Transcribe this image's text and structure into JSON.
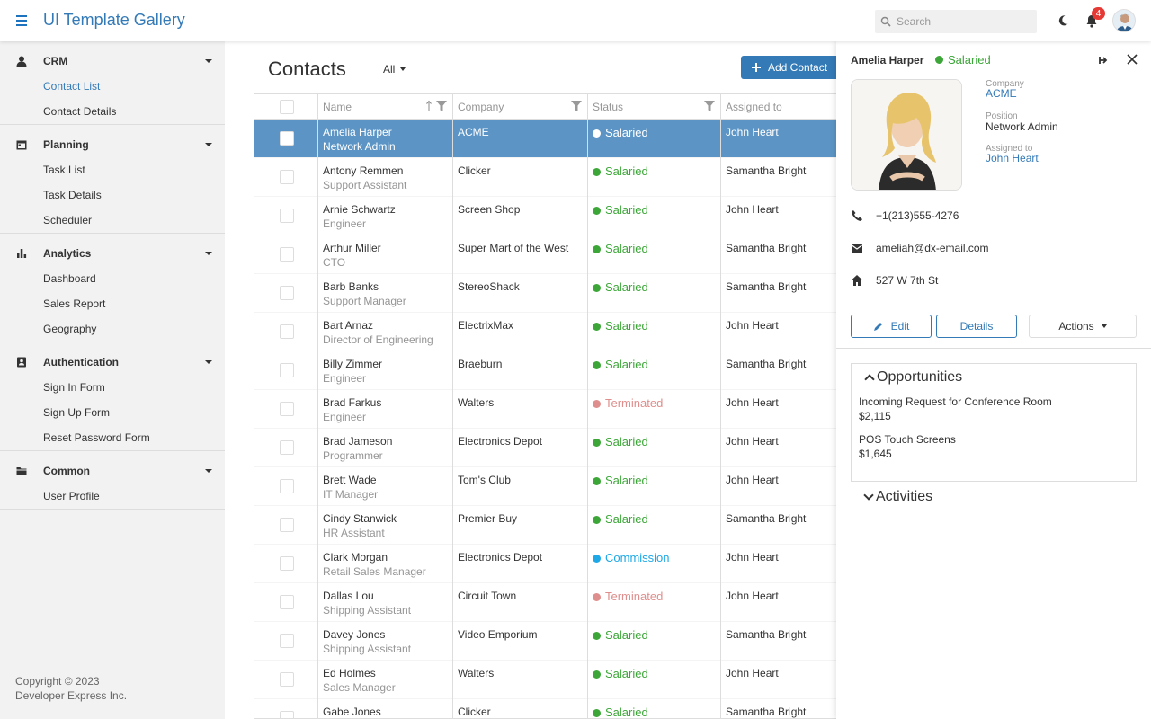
{
  "header": {
    "title": "UI Template Gallery",
    "search_placeholder": "Search",
    "notification_count": "4"
  },
  "sidebar": {
    "groups": [
      {
        "label": "CRM",
        "icon": "person-icon",
        "items": [
          "Contact List",
          "Contact Details"
        ]
      },
      {
        "label": "Planning",
        "icon": "calendar-icon",
        "items": [
          "Task List",
          "Task Details",
          "Scheduler"
        ]
      },
      {
        "label": "Analytics",
        "icon": "bar-chart-icon",
        "items": [
          "Dashboard",
          "Sales Report",
          "Geography"
        ]
      },
      {
        "label": "Authentication",
        "icon": "id-badge-icon",
        "items": [
          "Sign In Form",
          "Sign Up Form",
          "Reset Password Form"
        ]
      },
      {
        "label": "Common",
        "icon": "folder-icon",
        "items": [
          "User Profile"
        ]
      }
    ],
    "active_item": "Contact List",
    "copyright_line1": "Copyright © 2023",
    "copyright_line2": "Developer Express Inc."
  },
  "main": {
    "title": "Contacts",
    "filter_label": "All",
    "add_button": "Add Contact",
    "columns": {
      "name": "Name",
      "company": "Company",
      "status": "Status",
      "assigned": "Assigned to"
    },
    "rows": [
      {
        "name": "Amelia Harper",
        "position": "Network Admin",
        "company": "ACME",
        "status": "Salaried",
        "assigned": "John Heart",
        "selected": true
      },
      {
        "name": "Antony Remmen",
        "position": "Support Assistant",
        "company": "Clicker",
        "status": "Salaried",
        "assigned": "Samantha Bright"
      },
      {
        "name": "Arnie Schwartz",
        "position": "Engineer",
        "company": "Screen Shop",
        "status": "Salaried",
        "assigned": "John Heart"
      },
      {
        "name": "Arthur Miller",
        "position": "CTO",
        "company": "Super Mart of the West",
        "status": "Salaried",
        "assigned": "Samantha Bright"
      },
      {
        "name": "Barb Banks",
        "position": "Support Manager",
        "company": "StereoShack",
        "status": "Salaried",
        "assigned": "Samantha Bright"
      },
      {
        "name": "Bart Arnaz",
        "position": "Director of Engineering",
        "company": "ElectrixMax",
        "status": "Salaried",
        "assigned": "John Heart"
      },
      {
        "name": "Billy Zimmer",
        "position": "Engineer",
        "company": "Braeburn",
        "status": "Salaried",
        "assigned": "Samantha Bright"
      },
      {
        "name": "Brad Farkus",
        "position": "Engineer",
        "company": "Walters",
        "status": "Terminated",
        "assigned": "John Heart"
      },
      {
        "name": "Brad Jameson",
        "position": "Programmer",
        "company": "Electronics Depot",
        "status": "Salaried",
        "assigned": "John Heart"
      },
      {
        "name": "Brett Wade",
        "position": "IT Manager",
        "company": "Tom's Club",
        "status": "Salaried",
        "assigned": "John Heart"
      },
      {
        "name": "Cindy Stanwick",
        "position": "HR Assistant",
        "company": "Premier Buy",
        "status": "Salaried",
        "assigned": "Samantha Bright"
      },
      {
        "name": "Clark Morgan",
        "position": "Retail Sales Manager",
        "company": "Electronics Depot",
        "status": "Commission",
        "assigned": "John Heart"
      },
      {
        "name": "Dallas Lou",
        "position": "Shipping Assistant",
        "company": "Circuit Town",
        "status": "Terminated",
        "assigned": "John Heart"
      },
      {
        "name": "Davey Jones",
        "position": "Shipping Assistant",
        "company": "Video Emporium",
        "status": "Salaried",
        "assigned": "Samantha Bright"
      },
      {
        "name": "Ed Holmes",
        "position": "Sales Manager",
        "company": "Walters",
        "status": "Salaried",
        "assigned": "John Heart"
      },
      {
        "name": "Gabe Jones",
        "position": "",
        "company": "Clicker",
        "status": "Salaried",
        "assigned": "Samantha Bright"
      }
    ]
  },
  "status_colors": {
    "Salaried": "#3ca738",
    "Terminated": "#de8e8c",
    "Commission": "#1ea8e6"
  },
  "panel": {
    "name": "Amelia Harper",
    "status": "Salaried",
    "company_label": "Company",
    "company": "ACME",
    "position_label": "Position",
    "position": "Network Admin",
    "assigned_label": "Assigned to",
    "assigned": "John Heart",
    "phone": "+1(213)555-4276",
    "email": "ameliah@dx-email.com",
    "address": "527 W 7th St",
    "edit_button": "Edit",
    "details_button": "Details",
    "actions_button": "Actions",
    "opportunities_title": "Opportunities",
    "opportunities": [
      {
        "title": "Incoming Request for Conference Room",
        "amount": "$2,115"
      },
      {
        "title": "POS Touch Screens",
        "amount": "$1,645"
      }
    ],
    "activities_title": "Activities"
  }
}
